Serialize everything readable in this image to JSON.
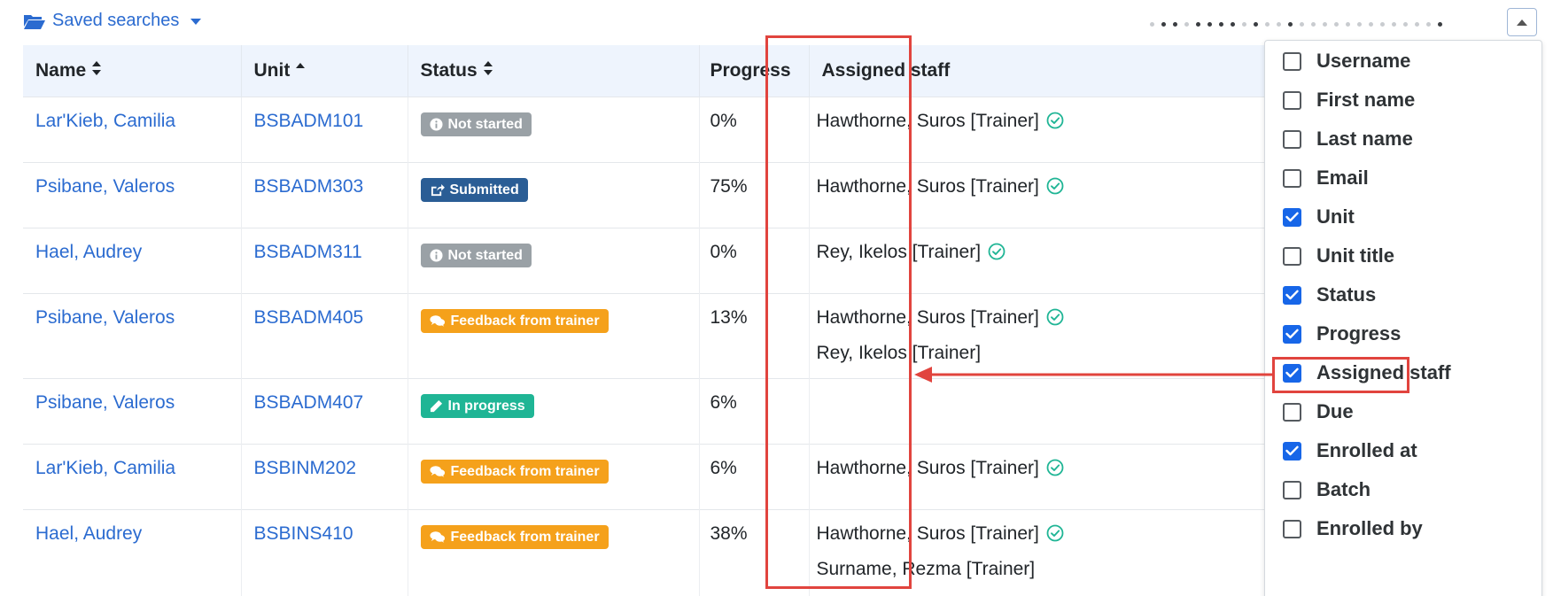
{
  "saved_searches": {
    "label": "Saved searches",
    "icon": "folder-open-icon"
  },
  "pager": {
    "dots": 26,
    "dark": [
      2,
      3,
      5,
      6,
      7,
      8,
      10,
      13,
      26
    ]
  },
  "table": {
    "columns": [
      {
        "label": "Name",
        "sort": "both"
      },
      {
        "label": "Unit",
        "sort": "asc"
      },
      {
        "label": "Status",
        "sort": "both"
      },
      {
        "label": "Progress",
        "sort": "none"
      },
      {
        "label": "Assigned staff",
        "sort": "none"
      }
    ],
    "rows": [
      {
        "name": "Lar'Kieb, Camilia",
        "unit": "BSBADM101",
        "status": "Not started",
        "status_type": "grey",
        "status_icon": "info-icon",
        "progress": "0%",
        "staff": [
          {
            "label": "Hawthorne, Suros [Trainer]",
            "check": true
          }
        ]
      },
      {
        "name": "Psibane, Valeros",
        "unit": "BSBADM303",
        "status": "Submitted",
        "status_type": "blue",
        "status_icon": "share-icon",
        "progress": "75%",
        "staff": [
          {
            "label": "Hawthorne, Suros [Trainer]",
            "check": true
          }
        ]
      },
      {
        "name": "Hael, Audrey",
        "unit": "BSBADM311",
        "status": "Not started",
        "status_type": "grey",
        "status_icon": "info-icon",
        "progress": "0%",
        "staff": [
          {
            "label": "Rey, Ikelos [Trainer]",
            "check": true
          }
        ]
      },
      {
        "name": "Psibane, Valeros",
        "unit": "BSBADM405",
        "status": "Feedback from trainer",
        "status_type": "orange",
        "status_icon": "comments-icon",
        "progress": "13%",
        "staff": [
          {
            "label": "Hawthorne, Suros [Trainer]",
            "check": true
          },
          {
            "label": "Rey, Ikelos [Trainer]",
            "check": false
          }
        ]
      },
      {
        "name": "Psibane, Valeros",
        "unit": "BSBADM407",
        "status": "In progress",
        "status_type": "green",
        "status_icon": "pencil-icon",
        "progress": "6%",
        "staff": []
      },
      {
        "name": "Lar'Kieb, Camilia",
        "unit": "BSBINM202",
        "status": "Feedback from trainer",
        "status_type": "orange",
        "status_icon": "comments-icon",
        "progress": "6%",
        "staff": [
          {
            "label": "Hawthorne, Suros [Trainer]",
            "check": true
          }
        ]
      },
      {
        "name": "Hael, Audrey",
        "unit": "BSBINS410",
        "status": "Feedback from trainer",
        "status_type": "orange",
        "status_icon": "comments-icon",
        "progress": "38%",
        "staff": [
          {
            "label": "Hawthorne, Suros [Trainer]",
            "check": true
          },
          {
            "label": "Surname, Rezma [Trainer]",
            "check": false
          }
        ]
      }
    ]
  },
  "column_chooser": {
    "options": [
      {
        "label": "Username",
        "checked": false
      },
      {
        "label": "First name",
        "checked": false
      },
      {
        "label": "Last name",
        "checked": false
      },
      {
        "label": "Email",
        "checked": false
      },
      {
        "label": "Unit",
        "checked": true
      },
      {
        "label": "Unit title",
        "checked": false
      },
      {
        "label": "Status",
        "checked": true
      },
      {
        "label": "Progress",
        "checked": true
      },
      {
        "label": "Assigned staff",
        "checked": true
      },
      {
        "label": "Due",
        "checked": false
      },
      {
        "label": "Enrolled at",
        "checked": true
      },
      {
        "label": "Batch",
        "checked": false
      },
      {
        "label": "Enrolled by",
        "checked": false
      }
    ]
  },
  "colors": {
    "link": "#2b6bd0",
    "highlight": "#e1443e",
    "checkbox": "#1766e8",
    "check_ok": "#1fb595"
  }
}
